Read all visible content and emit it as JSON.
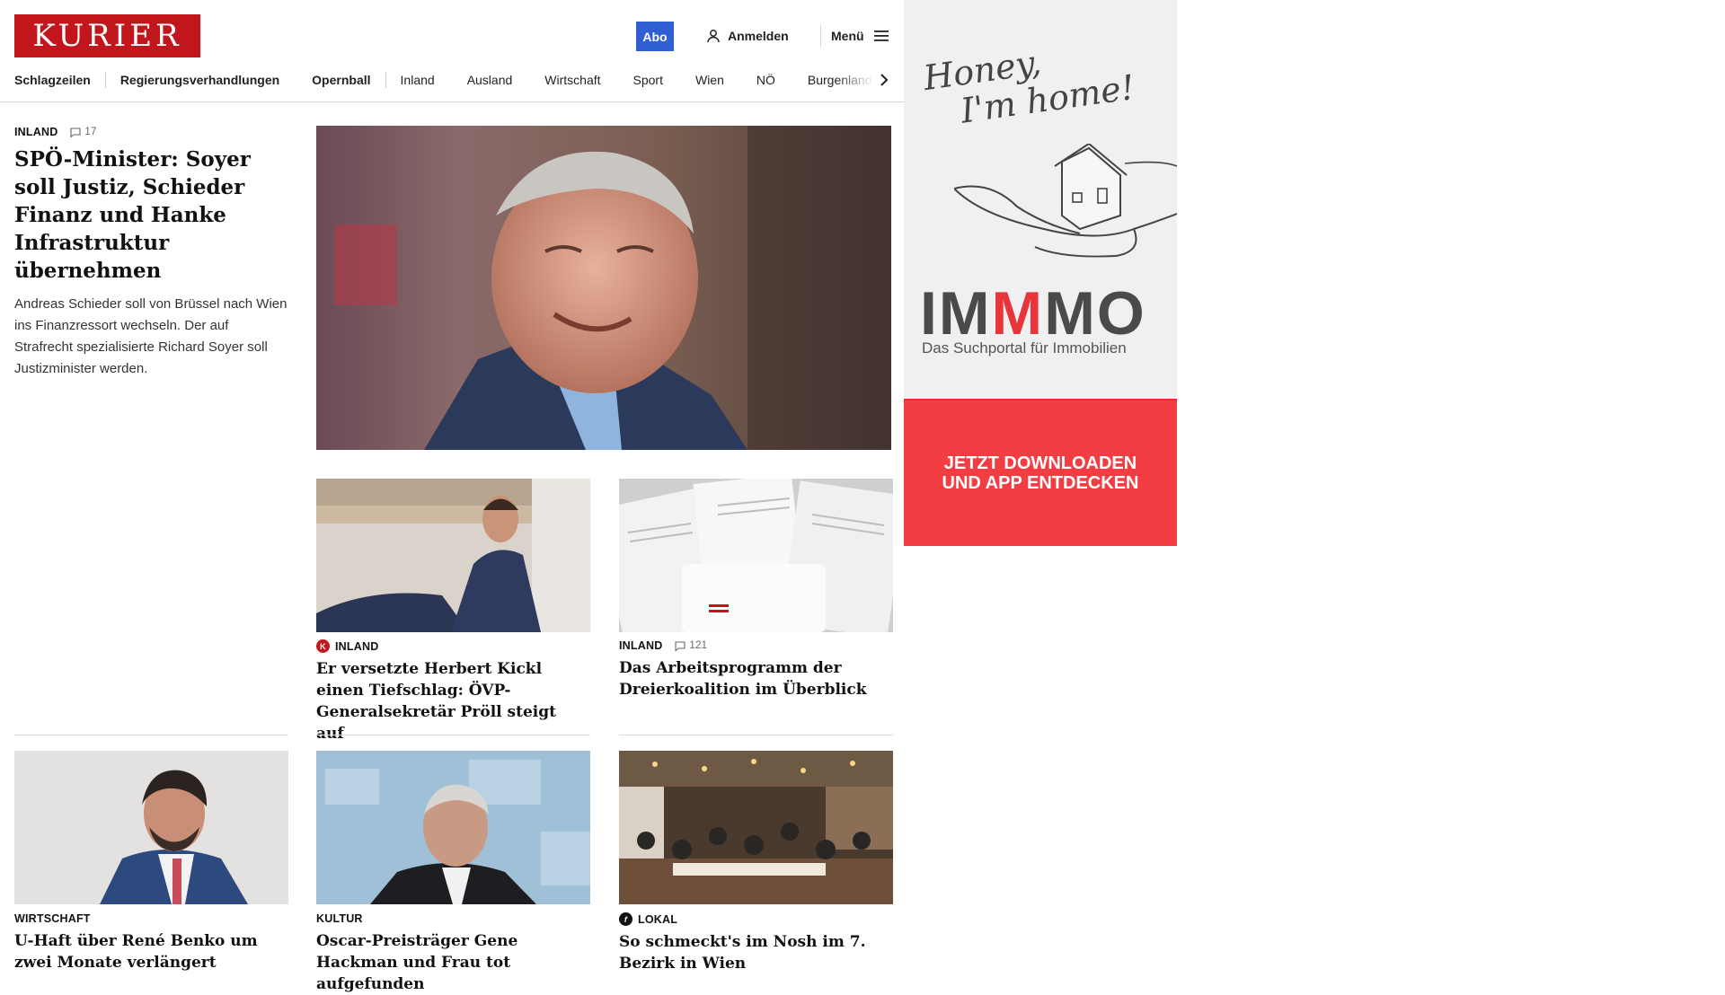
{
  "header": {
    "logo": "KURIER",
    "abo_label": "Abo",
    "login_label": "Anmelden",
    "menu_label": "Menü"
  },
  "nav": {
    "items": [
      "Schlagzeilen",
      "Regierungsverhandlungen",
      "Opernball",
      "Inland",
      "Ausland",
      "Wirtschaft",
      "Sport",
      "Wien",
      "NÖ",
      "Burgenland"
    ]
  },
  "lead": {
    "category": "INLAND",
    "comments": "17",
    "title": "SPÖ-Minister: Soyer soll Justiz, Schieder Finanz und Hanke Infrastruktur übernehmen",
    "teaser": "Andreas Schieder soll von Brüssel nach Wien ins Finanzressort wechseln. Der auf Strafrecht spezialisierte Richard Soyer soll Justizminister werden."
  },
  "cards": [
    {
      "category": "INLAND",
      "title": "Er versetzte Herbert Kickl einen Tiefschlag: ÖVP-Generalsekretär Pröll steigt auf",
      "badge": "K"
    },
    {
      "category": "INLAND",
      "comments": "121",
      "title": "Das Arbeitsprogramm der Dreierkoalition im Überblick"
    },
    {
      "category": "WIRTSCHAFT",
      "title": "U-Haft über René Benko um zwei Monate verlängert"
    },
    {
      "category": "KULTUR",
      "title": "Oscar-Preisträger Gene Hackman und Frau tot aufgefunden"
    },
    {
      "category": "LOKAL",
      "title": "So schmeckt's im Nosh im 7. Bezirk in Wien",
      "badge": "f"
    }
  ],
  "ad": {
    "script_line1": "Honey,",
    "script_line2": "I'm home!",
    "brand_a": "IM",
    "brand_m": "M",
    "brand_b": "MO",
    "tagline": "Das Suchportal für Immobilien",
    "cta_line1": "JETZT DOWNLOADEN",
    "cta_line2": "UND APP ENTDECKEN"
  },
  "icons": [
    "person-icon",
    "hamburger-icon",
    "chevron-right-icon",
    "comment-icon"
  ],
  "colors": {
    "brand_red": "#c2161d",
    "abo_blue": "#2f5fd3",
    "ad_red": "#f23d42"
  }
}
